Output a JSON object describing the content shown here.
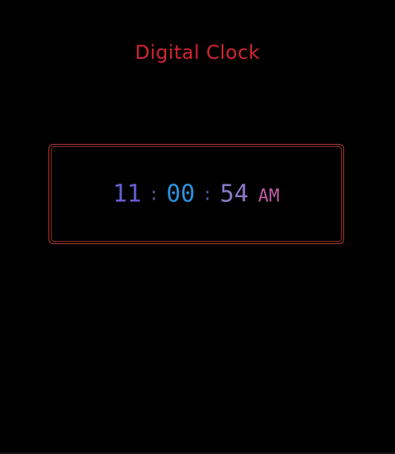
{
  "page": {
    "title": "Digital Clock"
  },
  "clock": {
    "hours": "11",
    "minutes": "00",
    "seconds": "54",
    "separator": ":",
    "meridiem": "AM"
  },
  "colors": {
    "title": "#d3262f",
    "frame": "#b23a2f",
    "hours": "#6a5ed6",
    "minutes": "#2b92dd",
    "seconds": "#8b78c8",
    "meridiem": "#bf5ea4",
    "background": "#000000"
  }
}
